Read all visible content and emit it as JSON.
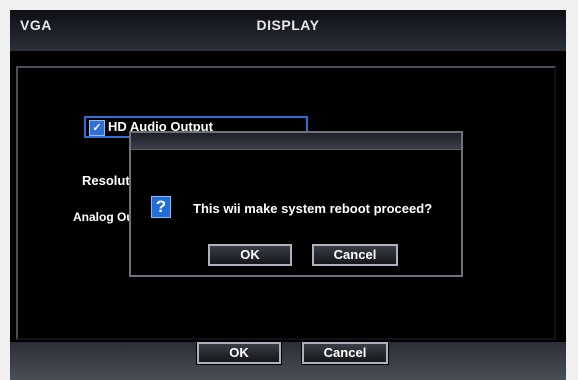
{
  "window": {
    "left_title": "VGA",
    "center_title": "DISPLAY"
  },
  "settings": {
    "hd_audio_label": "HD Audio Output",
    "hd_audio_checked": true,
    "resolution_label": "Resolution",
    "analog_label": "Analog Output"
  },
  "footer": {
    "ok_label": "OK",
    "cancel_label": "Cancel"
  },
  "dialog": {
    "icon": "question-icon",
    "icon_glyph": "?",
    "message": "This wii make system reboot proceed?",
    "ok_label": "OK",
    "cancel_label": "Cancel"
  },
  "colors": {
    "accent": "#2f6fd6",
    "background": "#000000"
  }
}
